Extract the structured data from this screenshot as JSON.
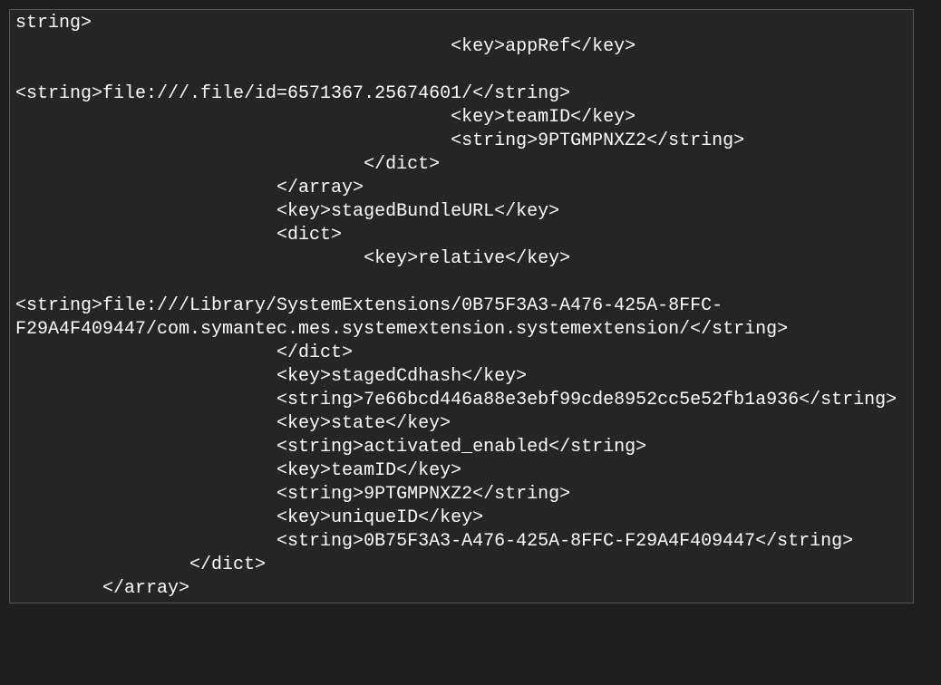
{
  "lines": [
    "string>",
    "                                        <key>appRef</key>",
    "                                        <string>file:///.file/id=6571367.25674601/</string>",
    "                                        <key>teamID</key>",
    "                                        <string>9PTGMPNXZ2</string>",
    "                                </dict>",
    "                        </array>",
    "                        <key>stagedBundleURL</key>",
    "                        <dict>",
    "                                <key>relative</key>",
    "                                <string>file:///Library/SystemExtensions/0B75F3A3-A476-425A-8FFC-F29A4F409447/com.symantec.mes.systemextension.systemextension/</string>",
    "                        </dict>",
    "                        <key>stagedCdhash</key>",
    "                        <string>7e66bcd446a88e3ebf99cde8952cc5e52fb1a936</string>",
    "                        <key>state</key>",
    "                        <string>activated_enabled</string>",
    "                        <key>teamID</key>",
    "                        <string>9PTGMPNXZ2</string>",
    "                        <key>uniqueID</key>",
    "                        <string>0B75F3A3-A476-425A-8FFC-F29A4F409447</string>",
    "                </dict>",
    "        </array>"
  ]
}
